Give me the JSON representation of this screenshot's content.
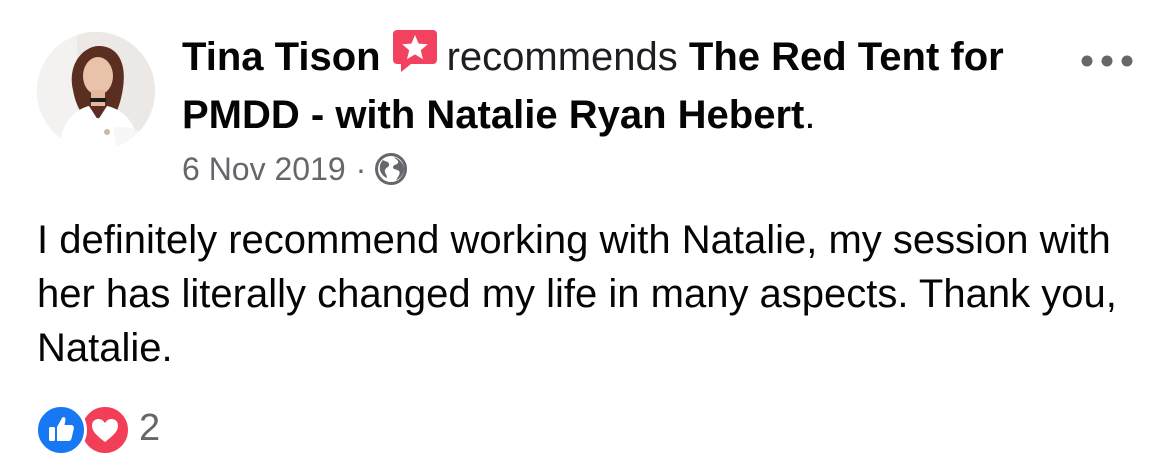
{
  "post": {
    "author": "Tina Tison",
    "verb": "recommends",
    "page_name": "The Red Tent for PMDD - with Natalie Ryan Hebert",
    "page_suffix": ".",
    "date": "6 Nov 2019",
    "separator": "·",
    "audience_icon": "globe-icon",
    "body": "I definitely recommend working with Natalie, my session with her has literally changed my life in many aspects. Thank you, Natalie.",
    "reactions": {
      "icons": [
        "like-icon",
        "love-icon"
      ],
      "count": "2"
    }
  },
  "colors": {
    "like": "#1877f2",
    "love": "#f33e58",
    "recommend_badge": "#f3425f",
    "meta_gray": "#65676b",
    "text": "#050505"
  }
}
